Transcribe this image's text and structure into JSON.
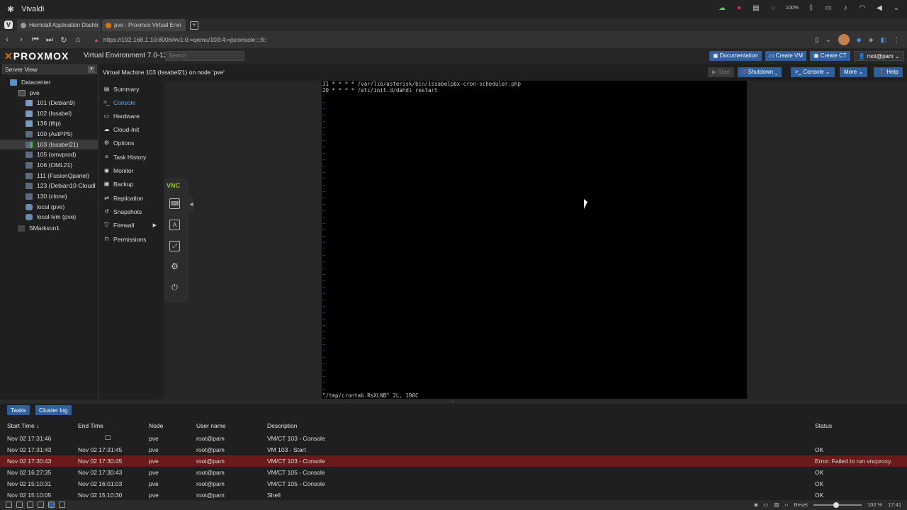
{
  "os": {
    "app_name": "Vivaldi",
    "battery": "100%"
  },
  "browser": {
    "tabs": [
      {
        "label": "Heimdall Application Dashb"
      },
      {
        "label": "pve - Proxmox Virtual Envi"
      }
    ],
    "url": "https://192.168.1.10:8006/#v1:0:=qemu/103:4:=jsconsole:::8::"
  },
  "pve": {
    "logo": "PROXMOX",
    "version": "Virtual Environment 7.0-13",
    "search_placeholder": "Search",
    "header_buttons": {
      "documentation": "Documentation",
      "create_vm": "Create VM",
      "create_ct": "Create CT",
      "user": "root@pam"
    },
    "view_selector": "Server View",
    "tree": [
      {
        "label": "Datacenter",
        "icon": "datacenter-icon"
      },
      {
        "label": "pve",
        "icon": "node-icon"
      },
      {
        "label": "101 (Debian9)",
        "icon": "vm-icon"
      },
      {
        "label": "102 (Issabel)",
        "icon": "vm-icon"
      },
      {
        "label": "136 (tftp)",
        "icon": "vm-icon"
      },
      {
        "label": "100 (AstPP5)",
        "icon": "vm-icon"
      },
      {
        "label": "103 (Issabel21)",
        "icon": "vm-running-icon"
      },
      {
        "label": "105 (omvprod)",
        "icon": "vm-icon"
      },
      {
        "label": "106 (OML21)",
        "icon": "vm-icon"
      },
      {
        "label": "111 (FusionQpanel)",
        "icon": "vm-icon"
      },
      {
        "label": "123 (Debian10-Cloudl",
        "icon": "vm-icon"
      },
      {
        "label": "130 (clone)",
        "icon": "vm-icon"
      },
      {
        "label": "local (pve)",
        "icon": "storage-icon"
      },
      {
        "label": "local-lvm (pve)",
        "icon": "storage-icon"
      },
      {
        "label": "SMarkson1",
        "icon": "tag-icon"
      }
    ],
    "vm_title": "Virtual Machine 103 (Issabel21) on node 'pve'",
    "vm_buttons": {
      "start": "Start",
      "shutdown": "Shutdown",
      "console": "Console",
      "more": "More",
      "help": "Help"
    },
    "vm_menu": [
      {
        "label": "Summary",
        "icon": "summary-icon",
        "glyph": "▤"
      },
      {
        "label": "Console",
        "icon": "console-icon",
        "glyph": ">_"
      },
      {
        "label": "Hardware",
        "icon": "hardware-icon",
        "glyph": "▭"
      },
      {
        "label": "Cloud-Init",
        "icon": "cloud-icon",
        "glyph": "☁"
      },
      {
        "label": "Options",
        "icon": "gear-icon",
        "glyph": "⚙"
      },
      {
        "label": "Task History",
        "icon": "list-icon",
        "glyph": "≡"
      },
      {
        "label": "Monitor",
        "icon": "eye-icon",
        "glyph": "◉"
      },
      {
        "label": "Backup",
        "icon": "floppy-icon",
        "glyph": "▣"
      },
      {
        "label": "Replication",
        "icon": "retweet-icon",
        "glyph": "⇄"
      },
      {
        "label": "Snapshots",
        "icon": "history-icon",
        "glyph": "↺"
      },
      {
        "label": "Firewall",
        "icon": "shield-icon",
        "glyph": "⛉"
      },
      {
        "label": "Permissions",
        "icon": "unlock-icon",
        "glyph": "🔓"
      }
    ],
    "vnc": {
      "logo": "VNC"
    },
    "terminal": {
      "lines": [
        "31 * * * * /var/lib/asterisk/bin/issabelpbx-cron-scheduler.php",
        "20 * * * * /etc/init.d/dahdi restart"
      ],
      "status_line": "\"/tmp/crontab.RsXLNB\" 2L, 100C",
      "tilde": "~"
    },
    "tasks": {
      "tab_tasks": "Tasks",
      "tab_cluster_log": "Cluster log",
      "columns": {
        "start": "Start Time ↓",
        "end": "End Time",
        "node": "Node",
        "user": "User name",
        "desc": "Description",
        "status": "Status"
      },
      "rows": [
        {
          "start": "Nov 02 17:31:46",
          "end": "",
          "node": "pve",
          "user": "root@pam",
          "desc": "VM/CT 103 - Console",
          "status": ""
        },
        {
          "start": "Nov 02 17:31:43",
          "end": "Nov 02 17:31:45",
          "node": "pve",
          "user": "root@pam",
          "desc": "VM 103 - Start",
          "status": "OK"
        },
        {
          "start": "Nov 02 17:30:43",
          "end": "Nov 02 17:30:45",
          "node": "pve",
          "user": "root@pam",
          "desc": "VM/CT 103 - Console",
          "status": "Error: Failed to run vncproxy."
        },
        {
          "start": "Nov 02 16:27:35",
          "end": "Nov 02 17:30:43",
          "node": "pve",
          "user": "root@pam",
          "desc": "VM/CT 105 - Console",
          "status": "OK"
        },
        {
          "start": "Nov 02 15:10:31",
          "end": "Nov 02 16:01:03",
          "node": "pve",
          "user": "root@pam",
          "desc": "VM/CT 105 - Console",
          "status": "OK"
        },
        {
          "start": "Nov 02 15:10:05",
          "end": "Nov 02 15:10:30",
          "node": "pve",
          "user": "root@pam",
          "desc": "Shell",
          "status": "OK"
        }
      ]
    }
  },
  "statusbar": {
    "reset": "Reset",
    "zoom": "100 %",
    "time": "17:41"
  },
  "colors": {
    "accent": "#2f5f9e",
    "error_row": "#6b1a1a",
    "brand": "#e57000"
  }
}
